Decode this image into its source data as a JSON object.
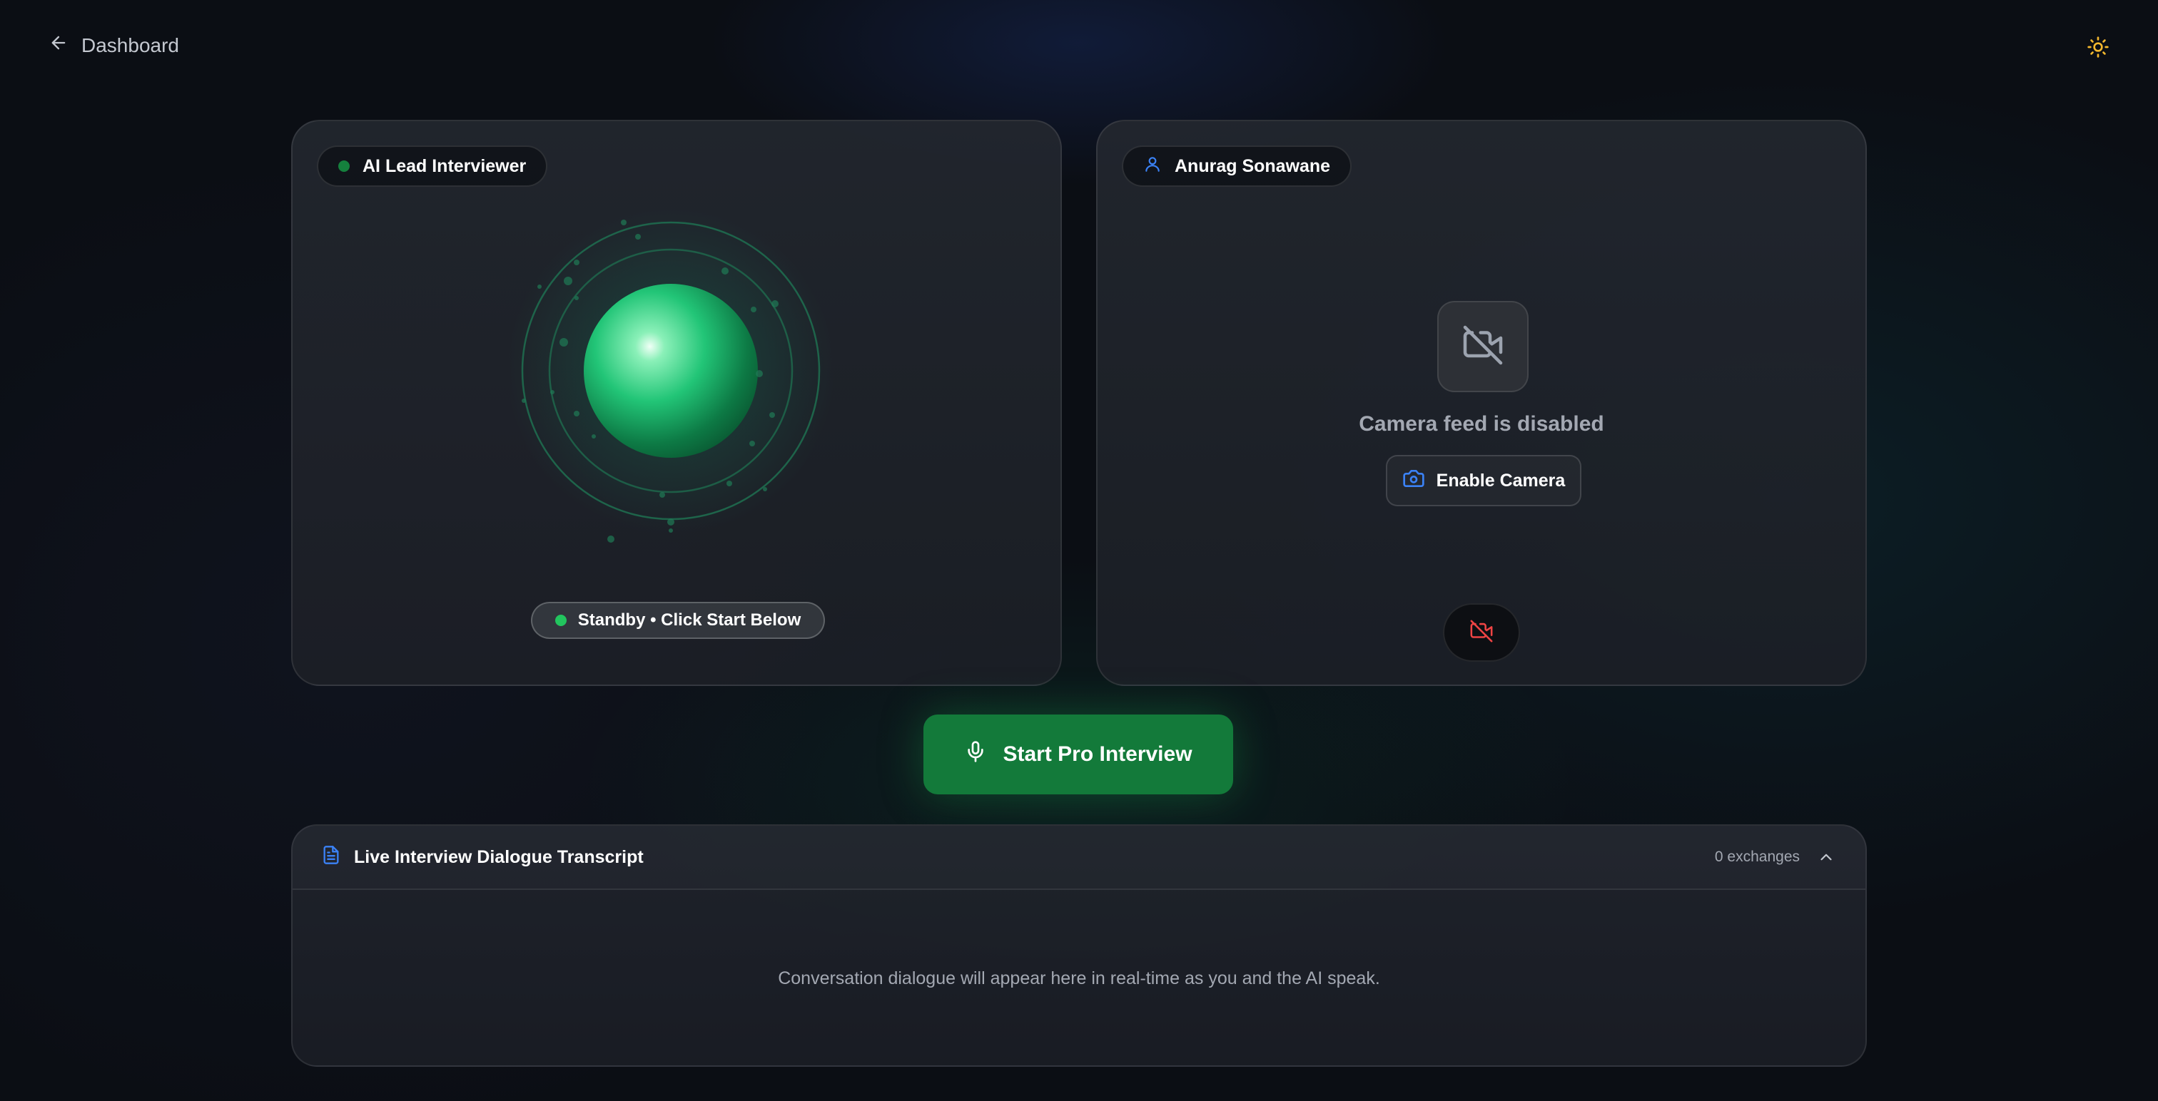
{
  "topbar": {
    "back_label": "Dashboard",
    "back_icon": "arrow-left-icon",
    "theme_icon": "sun-icon"
  },
  "ai_card": {
    "badge_label": "AI Lead Interviewer",
    "status_label": "Standby • Click Start Below"
  },
  "user_card": {
    "name": "Anurag Sonawane",
    "camera_message": "Camera feed is disabled",
    "enable_camera_label": "Enable Camera"
  },
  "start_button": {
    "label": "Start Pro Interview",
    "icon": "microphone-icon"
  },
  "transcript": {
    "title": "Live Interview Dialogue Transcript",
    "count_label": "0 exchanges",
    "empty_message": "Conversation dialogue will appear here in real-time as you and the AI speak."
  },
  "colors": {
    "accent_green": "#137a3a",
    "status_green": "#22c55e",
    "accent_blue": "#3b82f6",
    "danger_red": "#ef4444",
    "sun_yellow": "#f5b82e"
  }
}
